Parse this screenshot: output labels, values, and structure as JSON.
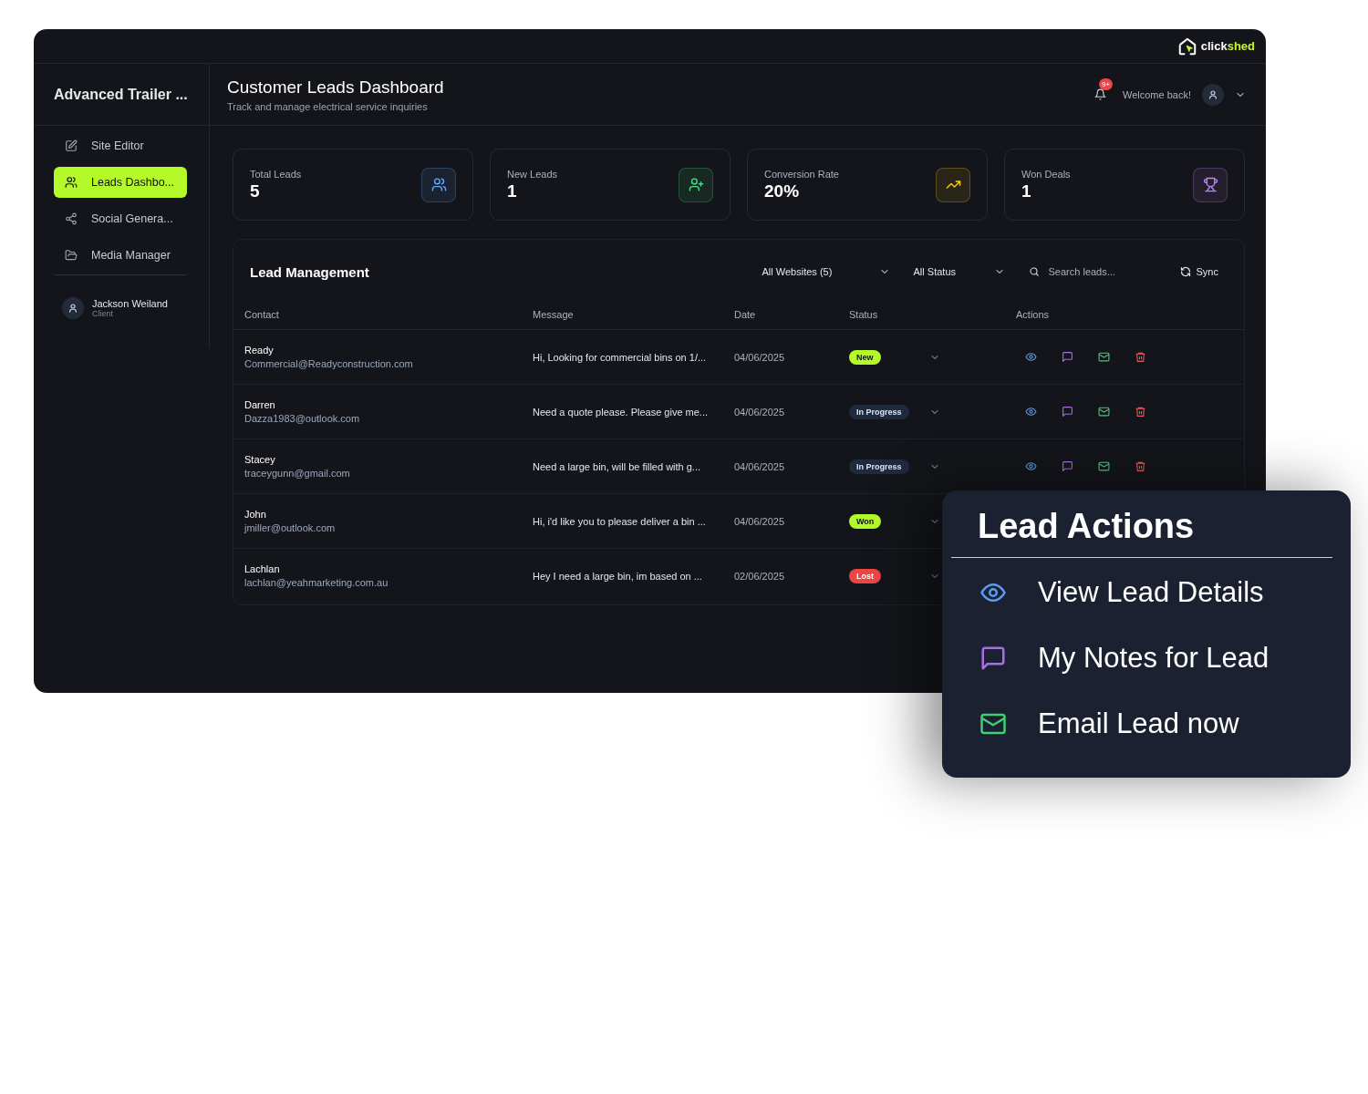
{
  "logo": {
    "part1": "click",
    "part2": "shed"
  },
  "sidebar": {
    "title": "Advanced Trailer ...",
    "items": [
      {
        "label": "Site Editor",
        "selected": false
      },
      {
        "label": "Leads Dashbo...",
        "selected": true
      },
      {
        "label": "Social Genera...",
        "selected": false
      },
      {
        "label": "Media Manager",
        "selected": false
      }
    ],
    "user": {
      "name": "Jackson Weiland",
      "role": "Client"
    }
  },
  "header": {
    "title": "Customer Leads Dashboard",
    "subtitle": "Track and manage electrical service inquiries",
    "notification_badge": "9+",
    "welcome": "Welcome back!"
  },
  "stats": [
    {
      "label": "Total Leads",
      "value": "5",
      "color": "#60a5fa"
    },
    {
      "label": "New Leads",
      "value": "1",
      "color": "#4ade80"
    },
    {
      "label": "Conversion Rate",
      "value": "20%",
      "color": "#facc15"
    },
    {
      "label": "Won Deals",
      "value": "1",
      "color": "#c084fc"
    }
  ],
  "lead_management": {
    "title": "Lead Management",
    "website_filter": "All Websites (5)",
    "status_filter": "All Status",
    "search": {
      "placeholder": "Search leads..."
    },
    "sync": "Sync",
    "columns": [
      "Contact",
      "Message",
      "Date",
      "Status",
      "Actions"
    ],
    "rows": [
      {
        "name": "Ready",
        "email": "Commercial@Readyconstruction.com",
        "message": "Hi, Looking for commercial bins on 1/...",
        "date": "04/06/2025",
        "status": "New",
        "color": "#b4f92a",
        "actions_covered": false
      },
      {
        "name": "Darren",
        "email": "Dazza1983@outlook.com",
        "message": "Need a quote please. Please give me...",
        "date": "04/06/2025",
        "status": "In Progress",
        "color": "#1e2a3d",
        "actions_covered": false
      },
      {
        "name": "Stacey",
        "email": "traceygunn@gmail.com",
        "message": "Need a large bin, will be filled with g...",
        "date": "04/06/2025",
        "status": "In Progress",
        "color": "#1e2a3d",
        "actions_covered": false
      },
      {
        "name": "John",
        "email": "jmiller@outlook.com",
        "message": "Hi, i'd like you to please deliver a bin ...",
        "date": "04/06/2025",
        "status": "Won",
        "color": "#b4f92a",
        "actions_covered": true
      },
      {
        "name": "Lachlan",
        "email": "lachlan@yeahmarketing.com.au",
        "message": "Hey I need a large bin, im based on ...",
        "date": "02/06/2025",
        "status": "Lost",
        "color": "#ef4444",
        "actions_covered": true
      }
    ]
  },
  "lead_actions_popup": {
    "title": "Lead Actions",
    "items": [
      {
        "label": "View Lead Details"
      },
      {
        "label": "My Notes for Lead"
      },
      {
        "label": "Email Lead now"
      }
    ]
  }
}
